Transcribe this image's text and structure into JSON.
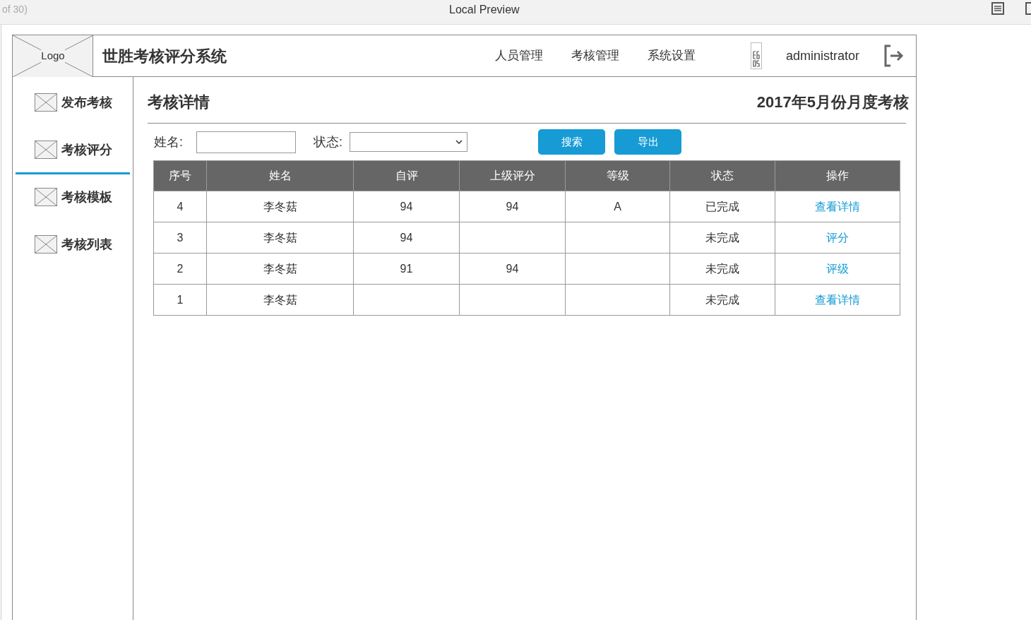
{
  "browser_bar": {
    "left_text": "of 30)",
    "title": "Local Preview"
  },
  "header": {
    "logo": "Logo",
    "app_title": "世胜考核评分系统",
    "nav": [
      "人员管理",
      "考核管理",
      "系统设置"
    ],
    "user": "administrator"
  },
  "sidebar": {
    "items": [
      {
        "label": "发布考核",
        "selected": false
      },
      {
        "label": "考核评分",
        "selected": true
      },
      {
        "label": "考核模板",
        "selected": false
      },
      {
        "label": "考核列表",
        "selected": false
      }
    ]
  },
  "content": {
    "title": "考核详情",
    "period": "2017年5月份月度考核",
    "filters": {
      "name_label": "姓名:",
      "status_label": "状态:",
      "search_button": "搜索",
      "export_button": "导出"
    },
    "table": {
      "columns": [
        "序号",
        "姓名",
        "自评",
        "上级评分",
        "等级",
        "状态",
        "操作"
      ],
      "rows": [
        {
          "cells": [
            "4",
            "李冬菇",
            "94",
            "94",
            "A",
            "已完成"
          ],
          "action": "查看详情"
        },
        {
          "cells": [
            "3",
            "李冬菇",
            "94",
            "",
            "",
            "未完成"
          ],
          "action": "评分"
        },
        {
          "cells": [
            "2",
            "李冬菇",
            "91",
            "94",
            "",
            "未完成"
          ],
          "action": "评级"
        },
        {
          "cells": [
            "1",
            "李冬菇",
            "",
            "",
            "",
            "未完成"
          ],
          "action": "查看详情"
        }
      ]
    }
  }
}
